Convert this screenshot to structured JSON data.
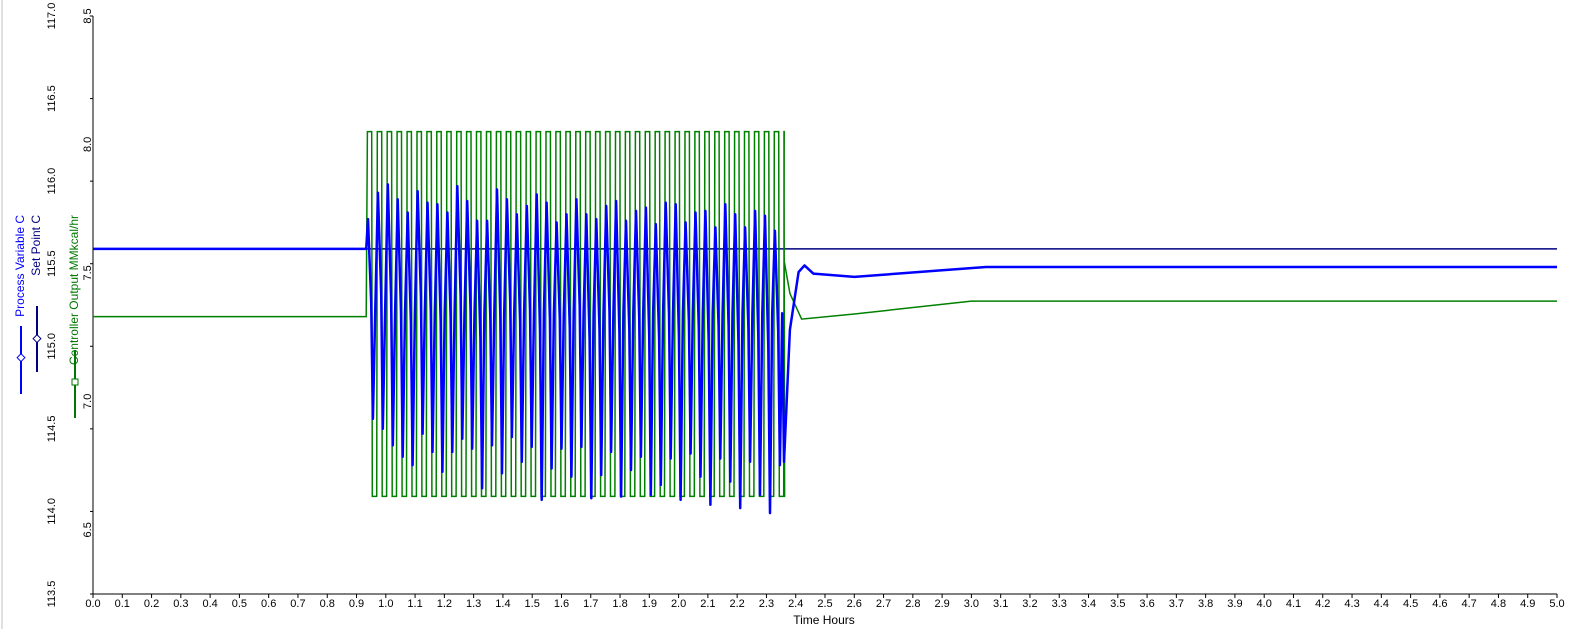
{
  "chart_data": {
    "type": "line",
    "xlabel": "Time Hours",
    "xlim": [
      0.0,
      5.0
    ],
    "x_ticks": [
      "0.0",
      "0.1",
      "0.2",
      "0.3",
      "0.4",
      "0.5",
      "0.6",
      "0.7",
      "0.8",
      "0.9",
      "1.0",
      "1.1",
      "1.2",
      "1.3",
      "1.4",
      "1.5",
      "1.6",
      "1.7",
      "1.8",
      "1.9",
      "2.0",
      "2.1",
      "2.2",
      "2.3",
      "2.4",
      "2.5",
      "2.6",
      "2.7",
      "2.8",
      "2.9",
      "3.0",
      "3.1",
      "3.2",
      "3.3",
      "3.4",
      "3.5",
      "3.6",
      "3.7",
      "3.8",
      "3.9",
      "4.0",
      "4.1",
      "4.2",
      "4.3",
      "4.4",
      "4.5",
      "4.6",
      "4.7",
      "4.8",
      "4.9",
      "5.0"
    ],
    "left_axis": {
      "ylim": [
        113.5,
        117.0
      ],
      "ticks": [
        "113.5",
        "114.0",
        "114.5",
        "115.0",
        "115.5",
        "116.0",
        "116.5",
        "117.0"
      ],
      "labels": [
        {
          "text": "Process Variable C",
          "color": "#0000ff"
        },
        {
          "text": "Set Point C",
          "color": "#000080"
        }
      ]
    },
    "right_axis": {
      "ylim": [
        6.25,
        8.5
      ],
      "ticks": [
        "6.5",
        "7.0",
        "7.5",
        "8.0",
        "8.5"
      ],
      "label": {
        "text": "Controller Output MMkcal/hr",
        "color": "#007800"
      }
    },
    "grid": false,
    "series": [
      {
        "name": "Set Point C",
        "color": "#000080",
        "axis": "left",
        "points": [
          [
            0.0,
            115.59
          ],
          [
            5.0,
            115.59
          ]
        ]
      },
      {
        "name": "Controller Output MMkcal/hr",
        "color": "#008000",
        "axis": "right",
        "cycling": {
          "start": 0.935,
          "end": 2.36,
          "period": 0.0339,
          "high": 8.05,
          "low": 6.63
        },
        "points": [
          [
            0.0,
            7.33
          ],
          [
            0.933,
            7.33
          ],
          [
            2.36,
            7.55
          ],
          [
            2.38,
            7.42
          ],
          [
            2.42,
            7.32
          ],
          [
            2.6,
            7.34
          ],
          [
            3.0,
            7.39
          ],
          [
            5.0,
            7.39
          ]
        ]
      },
      {
        "name": "Process Variable C",
        "color": "#0000ff",
        "axis": "left",
        "oscillation": {
          "start": 0.935,
          "end": 2.36,
          "period": 0.0339,
          "peaks": [
            115.77,
            115.93,
            115.98,
            115.89,
            115.81,
            115.94,
            115.87,
            115.86,
            115.81,
            115.97,
            115.88,
            115.76,
            115.76,
            115.95,
            115.89,
            115.8,
            115.85,
            115.92,
            115.87,
            115.75,
            115.8,
            115.89,
            115.8,
            115.77,
            115.85,
            115.88,
            115.76,
            115.82,
            115.84,
            115.74,
            115.87,
            115.86,
            115.75,
            115.81,
            115.82,
            115.72,
            115.86,
            115.8,
            115.72,
            115.82,
            115.79,
            115.7
          ],
          "troughs": [
            114.56,
            114.5,
            114.4,
            114.33,
            114.28,
            114.47,
            114.36,
            114.24,
            114.36,
            114.44,
            114.38,
            114.14,
            114.4,
            114.23,
            114.45,
            114.3,
            114.39,
            114.07,
            114.26,
            114.38,
            114.21,
            114.39,
            114.08,
            114.22,
            114.36,
            114.09,
            114.25,
            114.33,
            114.1,
            114.16,
            114.32,
            114.07,
            114.35,
            114.21,
            114.04,
            114.32,
            114.18,
            114.02,
            114.3,
            114.1,
            113.99,
            114.28
          ]
        },
        "points": [
          [
            0.0,
            115.59
          ],
          [
            0.933,
            115.59
          ],
          [
            2.36,
            114.3
          ],
          [
            2.38,
            115.1
          ],
          [
            2.41,
            115.45
          ],
          [
            2.43,
            115.49
          ],
          [
            2.46,
            115.44
          ],
          [
            2.6,
            115.42
          ],
          [
            2.9,
            115.46
          ],
          [
            3.05,
            115.48
          ],
          [
            5.0,
            115.48
          ]
        ]
      }
    ]
  }
}
